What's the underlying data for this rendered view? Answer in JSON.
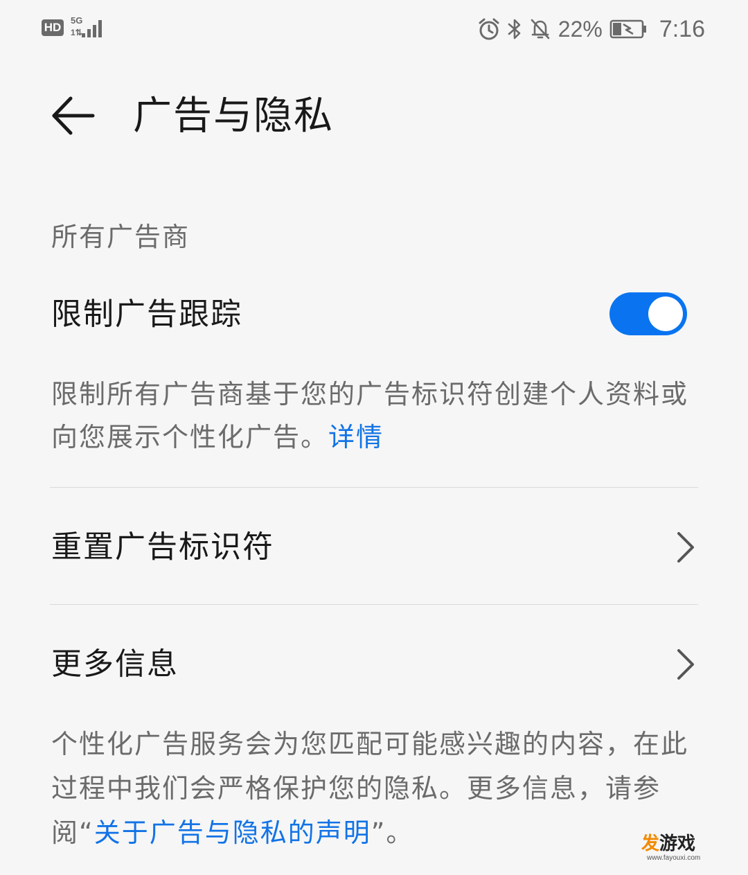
{
  "status_bar": {
    "hd_label": "HD",
    "network_type": "5G",
    "network_sub": "1⇅",
    "battery_percent": "22%",
    "time": "7:16",
    "icons": [
      "alarm-icon",
      "bluetooth-icon",
      "mute-bell-icon",
      "battery-icon",
      "signal-icon"
    ]
  },
  "header": {
    "title": "广告与隐私",
    "back_icon": "arrow-left-icon"
  },
  "section": {
    "title": "所有广告商"
  },
  "limit_tracking": {
    "label": "限制广告跟踪",
    "enabled": true,
    "description": "限制所有广告商基于您的广告标识符创建个人资料或向您展示个性化广告。",
    "link_text": "详情"
  },
  "menu": {
    "reset_id": "重置广告标识符",
    "more_info": "更多信息"
  },
  "footer": {
    "text_before": "个性化广告服务会为您匹配可能感兴趣的内容，在此过程中我们会严格保护您的隐私。更多信息，请参阅“",
    "link_text": "关于广告与隐私的声明",
    "text_after": "”。"
  },
  "watermark": {
    "text_first": "发",
    "text_rest": "游戏",
    "url": "www.fayouxi.com"
  },
  "colors": {
    "accent": "#0a74f0",
    "link": "#1273e6",
    "background": "#f6f6f6",
    "text_primary": "#191919",
    "text_secondary": "#6b6b6b"
  }
}
